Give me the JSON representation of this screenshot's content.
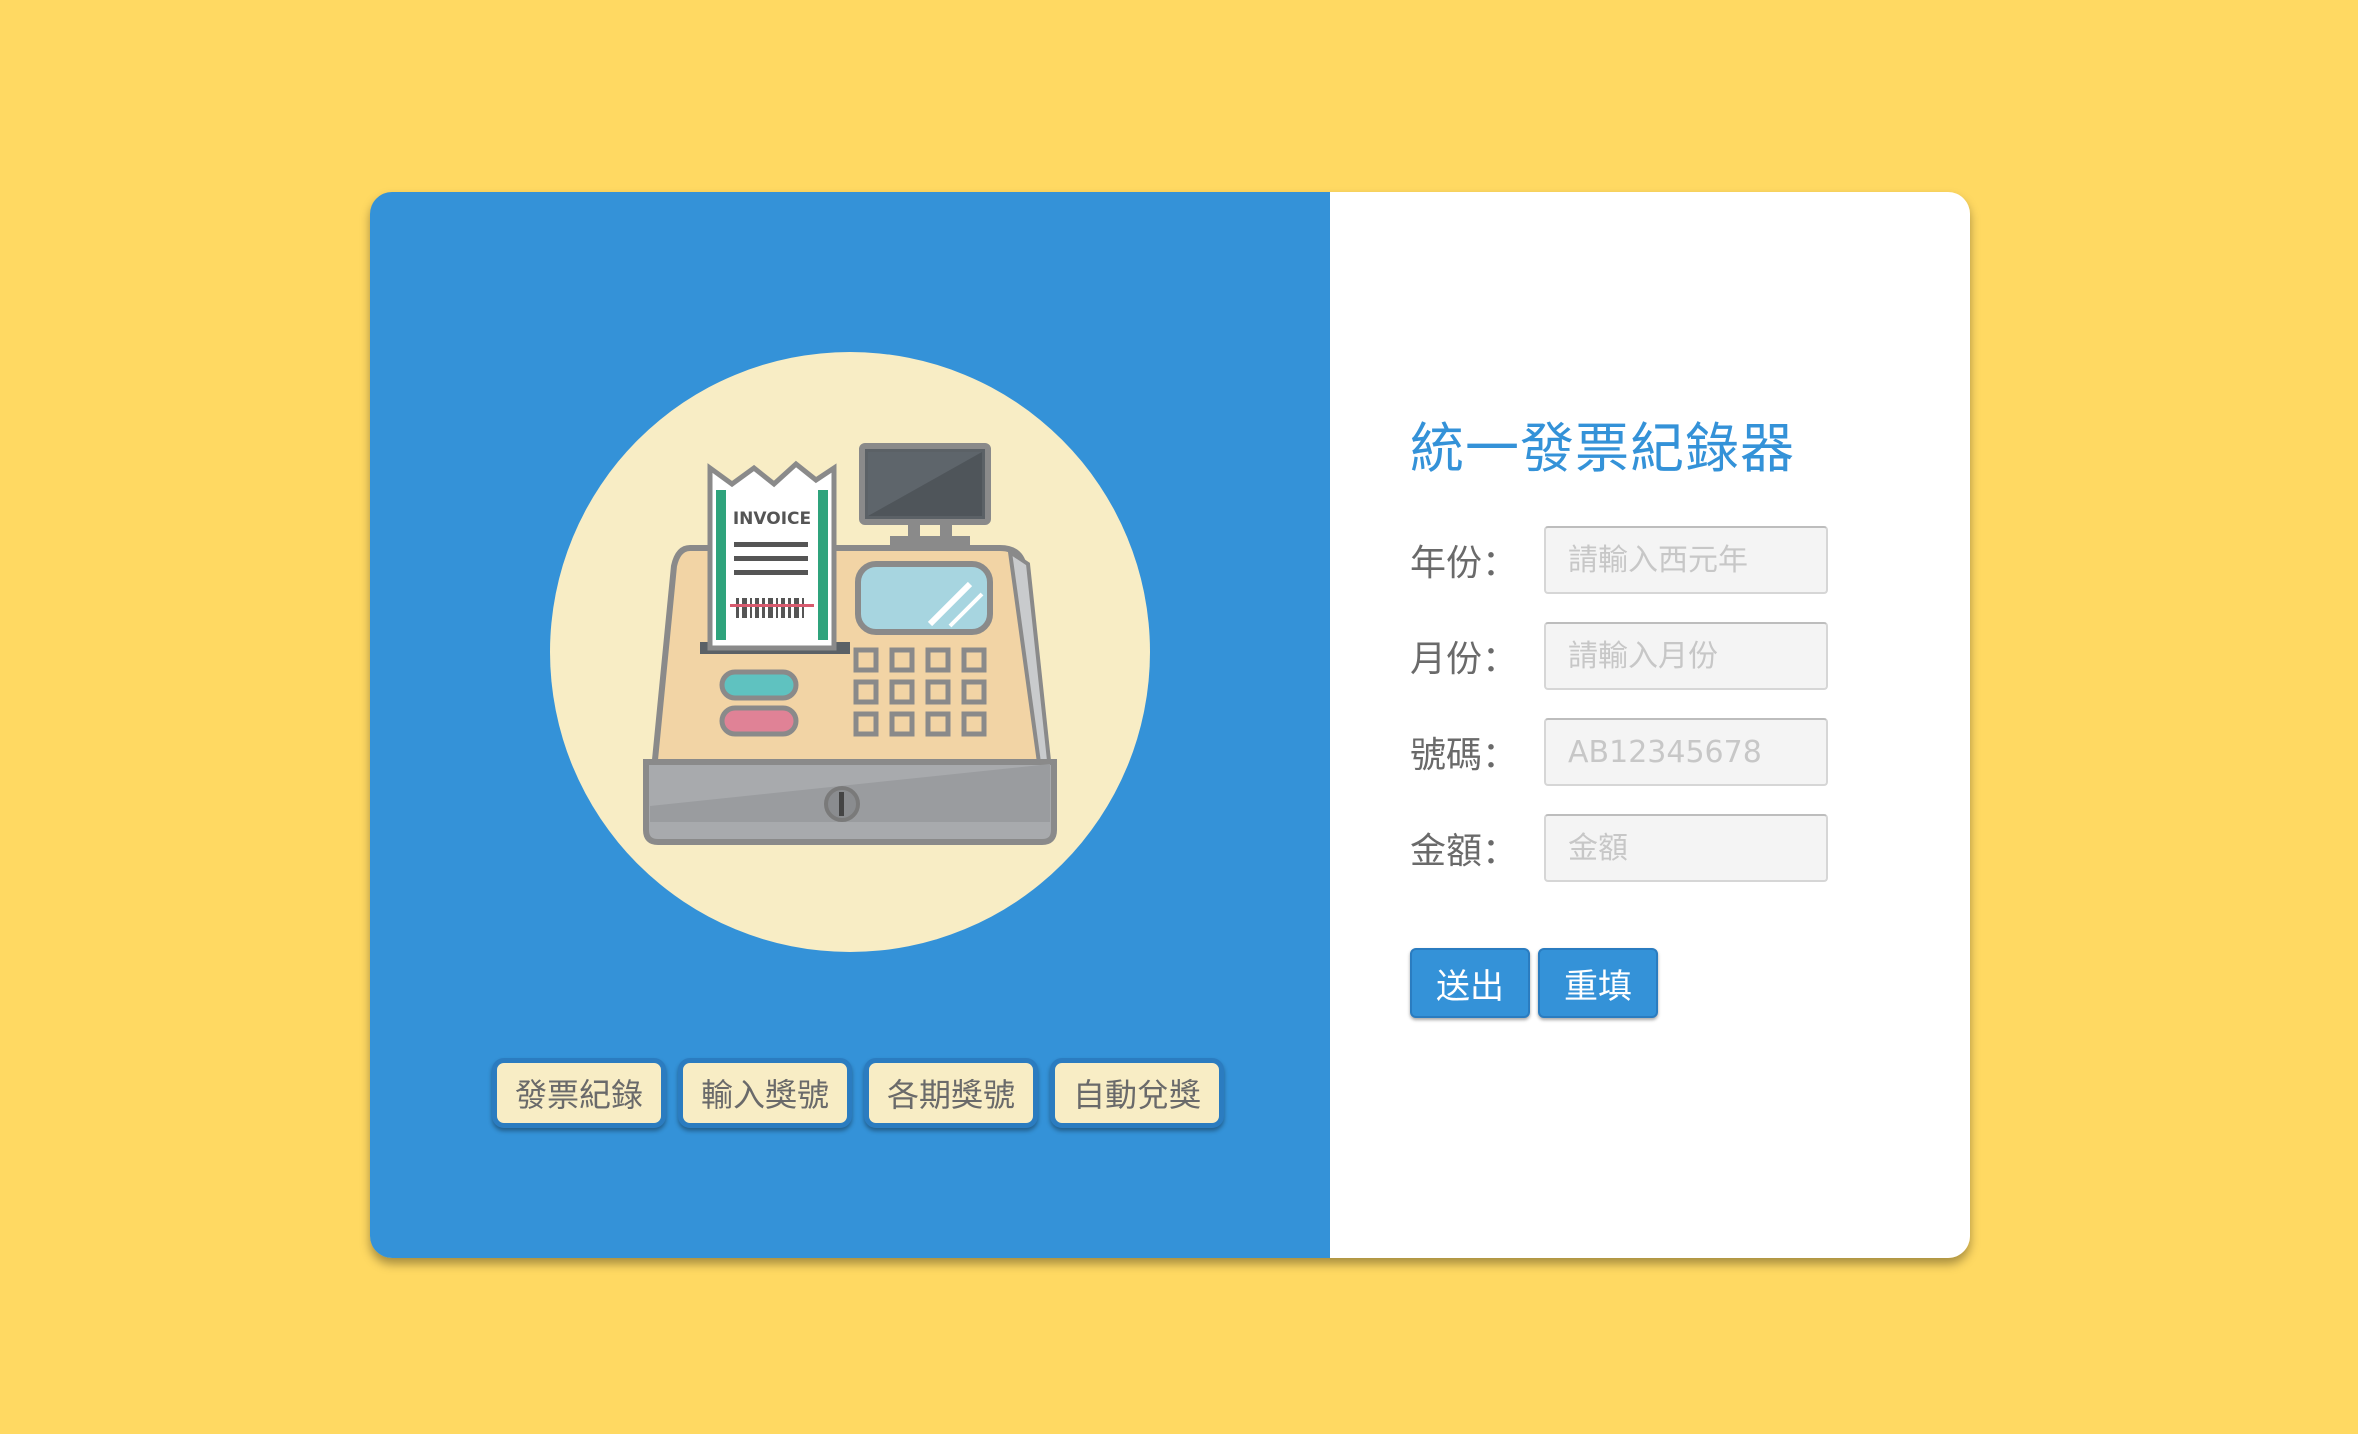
{
  "colors": {
    "background": "#FFD962",
    "panel_blue": "#3492D8",
    "circle": "#F8EDC5"
  },
  "illustration": {
    "icon": "cash-register-icon",
    "receipt_text": "INVOICE"
  },
  "nav": {
    "items": [
      {
        "label": "發票紀錄"
      },
      {
        "label": "輸入獎號"
      },
      {
        "label": "各期獎號"
      },
      {
        "label": "自動兌獎"
      }
    ]
  },
  "form": {
    "title": "統一發票紀錄器",
    "fields": [
      {
        "label": "年份：",
        "placeholder": "請輸入西元年",
        "value": ""
      },
      {
        "label": "月份：",
        "placeholder": "請輸入月份",
        "value": ""
      },
      {
        "label": "號碼：",
        "placeholder": "AB12345678",
        "value": ""
      },
      {
        "label": "金額：",
        "placeholder": "金額",
        "value": ""
      }
    ],
    "submit_label": "送出",
    "reset_label": "重填"
  }
}
